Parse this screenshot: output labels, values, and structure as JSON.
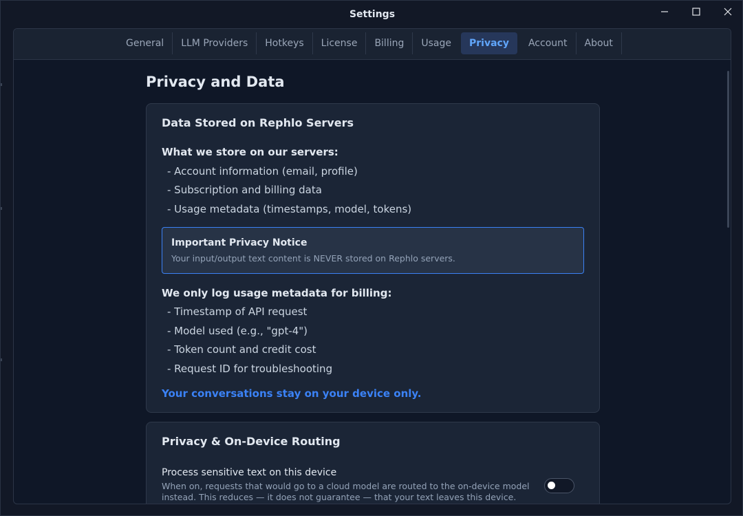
{
  "window": {
    "title": "Settings"
  },
  "tabs": [
    {
      "label": "General"
    },
    {
      "label": "LLM Providers"
    },
    {
      "label": "Hotkeys"
    },
    {
      "label": "License"
    },
    {
      "label": "Billing"
    },
    {
      "label": "Usage"
    },
    {
      "label": "Privacy",
      "active": true
    },
    {
      "label": "Account"
    },
    {
      "label": "About"
    }
  ],
  "page": {
    "title": "Privacy and Data"
  },
  "data_card": {
    "title": "Data Stored on Rephlo Servers",
    "store_heading": "What we store on our servers:",
    "store_items": [
      "- Account information (email, profile)",
      "- Subscription and billing data",
      "- Usage metadata (timestamps, model, tokens)"
    ],
    "notice_title": "Important Privacy Notice",
    "notice_text": "Your input/output text content is NEVER stored on Rephlo servers.",
    "log_heading": "We only log usage metadata for billing:",
    "log_items": [
      "- Timestamp of API request",
      "- Model used (e.g., \"gpt-4\")",
      "- Token count and credit cost",
      "- Request ID for troubleshooting"
    ],
    "highlight": "Your conversations stay on your device only."
  },
  "routing_card": {
    "title": "Privacy & On-Device Routing",
    "setting_label": "Process sensitive text on this device",
    "setting_desc": "When on, requests that would go to a cloud model are routed to the on-device model instead. This reduces — it does not guarantee — that your text leaves this device.",
    "toggle_on": false
  },
  "colors": {
    "accent": "#3b82f6",
    "background": "#121826",
    "card": "#1b2536"
  }
}
